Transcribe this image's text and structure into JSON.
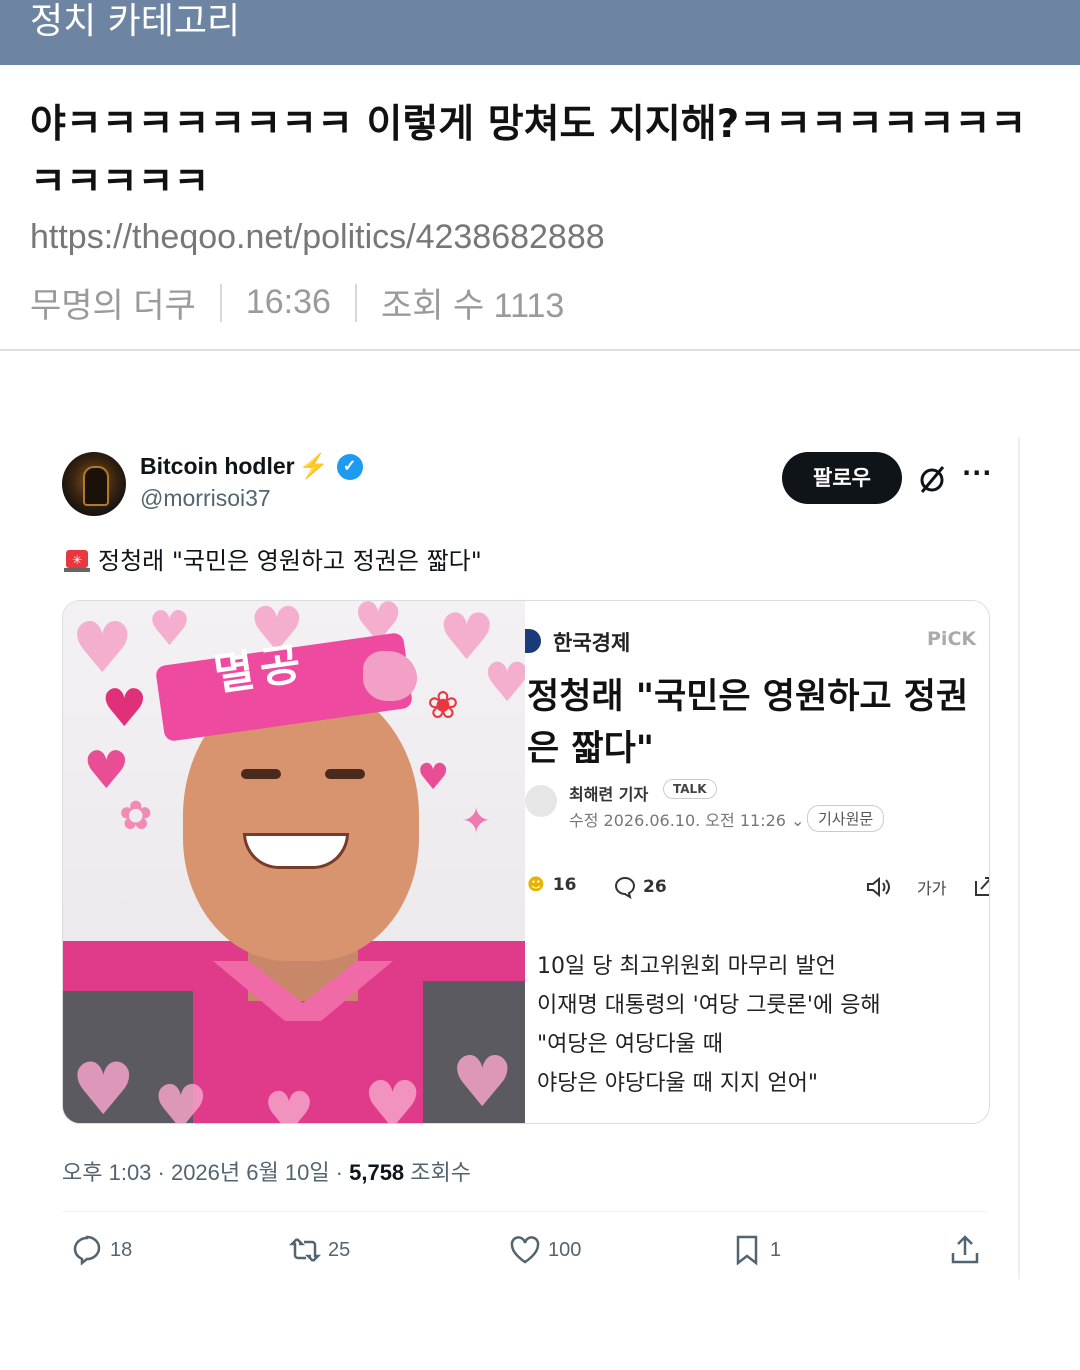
{
  "board": {
    "category": "정치 카테고리",
    "title": "야ㅋㅋㅋㅋㅋㅋㅋㅋ 이렇게 망쳐도 지지해?ㅋㅋㅋㅋㅋㅋㅋㅋㅋㅋㅋㅋㅋ",
    "url": "https://theqoo.net/politics/4238682888",
    "author": "무명의 더쿠",
    "time": "16:36",
    "views": "조회 수 1113"
  },
  "tweet": {
    "display_name": "Bitcoin hodler",
    "name_emoji": "⚡",
    "handle": "@morrisoi37",
    "follow_label": "팔로우",
    "text": "정청래 \"국민은 영원하고 정권은 짧다\"",
    "timestamp": "오후 1:03 · 2026년 6월 10일 · ",
    "view_count": "5,758",
    "view_label": " 조회수",
    "replies": "18",
    "retweets": "25",
    "likes": "100",
    "bookmarks": "1",
    "accent": "#1d9bf0"
  },
  "photo": {
    "headband_text": "멸공"
  },
  "news": {
    "publisher": "한국경제",
    "pick": "PiCK",
    "headline": "정청래 \"국민은 영원하고 정권\n은 짧다\"",
    "reporter": "최해련 기자",
    "talk": "TALK",
    "date": "수정 2026.06.10. 오전 11:26",
    "original": "기사원문",
    "reactions": "16",
    "comments": "26",
    "font_label": "가가",
    "body_lines": [
      "10일 당 최고위원회 마무리 발언",
      "이재명 대통령의 '여당 그룻론'에 응해",
      "\"여당은 여당다울 때",
      "야당은 야당다울 때 지지 얻어\""
    ]
  }
}
